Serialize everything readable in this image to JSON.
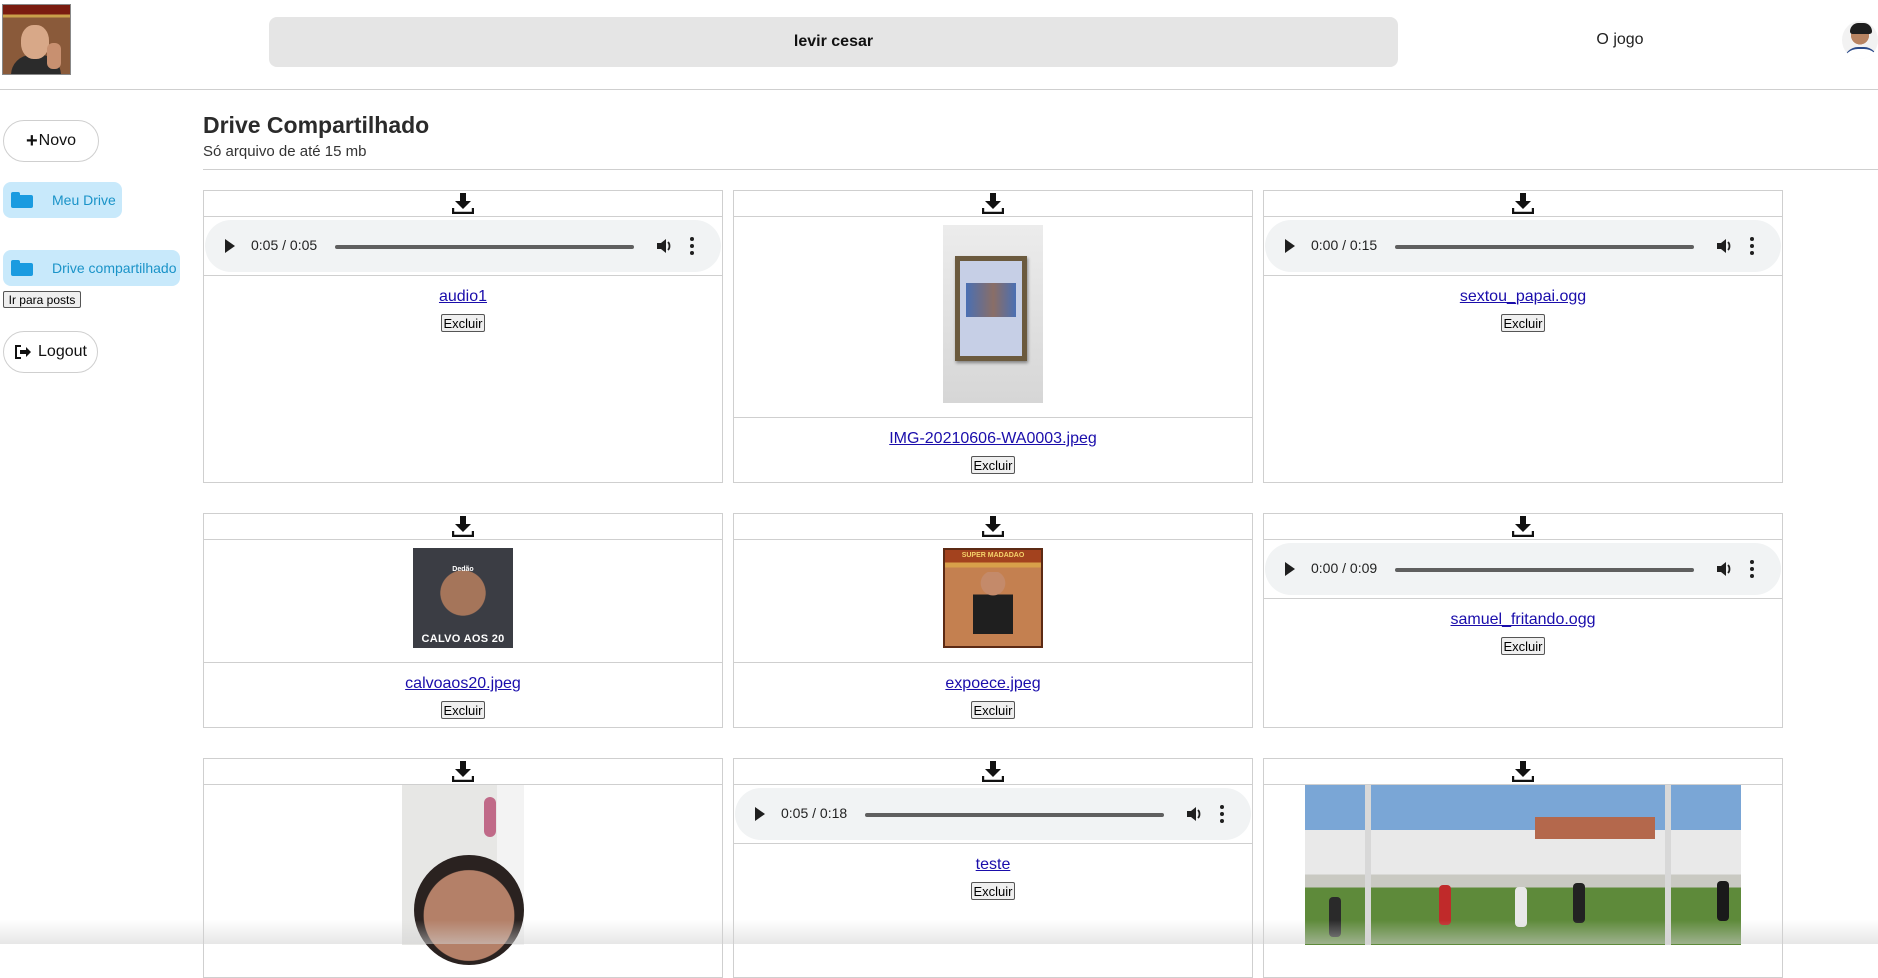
{
  "header": {
    "user_name": "levir cesar",
    "nav_link": "O jogo"
  },
  "sidebar": {
    "new_button": "Novo",
    "items": [
      {
        "label": "Meu Drive"
      },
      {
        "label": "Drive compartilhado"
      }
    ],
    "posts_button": "Ir para posts",
    "logout_button": "Logout"
  },
  "main": {
    "title": "Drive Compartilhado",
    "subtitle": "Só arquivo de até 15 mb",
    "delete_label": "Excluir",
    "files": [
      {
        "name": "audio1",
        "type": "audio",
        "time": "0:05 / 0:05",
        "progress": 1.0
      },
      {
        "name": "IMG-20210606-WA0003.jpeg",
        "type": "image"
      },
      {
        "name": "sextou_papai.ogg",
        "type": "audio",
        "time": "0:00 / 0:15",
        "progress": 0.0
      },
      {
        "name": "calvoaos20.jpeg",
        "type": "image",
        "image_text": [
          "Dedão",
          "CALVO AOS 20"
        ]
      },
      {
        "name": "expoece.jpeg",
        "type": "image",
        "image_text": "SUPER MADADAO"
      },
      {
        "name": "samuel_fritando.ogg",
        "type": "audio",
        "time": "0:00 / 0:09",
        "progress": 0.0
      },
      {
        "name": "",
        "type": "image"
      },
      {
        "name": "teste",
        "type": "audio",
        "time": "0:05 / 0:18",
        "progress": 0.34
      },
      {
        "name": "",
        "type": "video"
      }
    ]
  },
  "colors": {
    "accent_bg": "#c8e9fb",
    "accent_text": "#1a93c8",
    "link": "#1a0dab",
    "pill_bg": "#e5e5e5"
  }
}
